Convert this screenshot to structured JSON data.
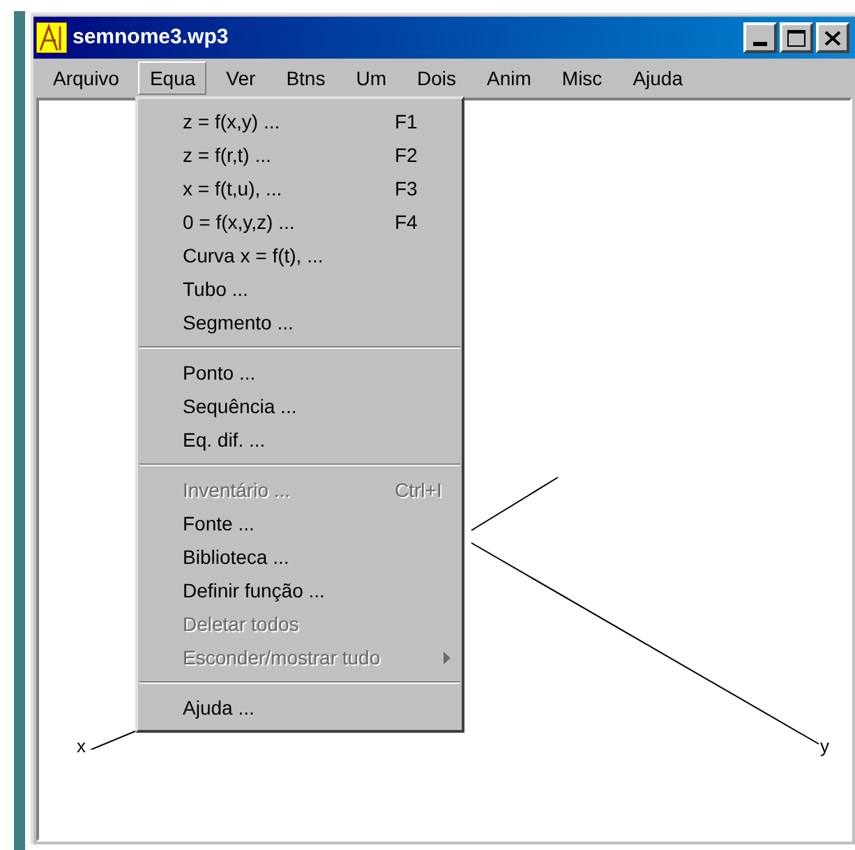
{
  "window": {
    "title": "semnome3.wp3"
  },
  "menu_bar": [
    {
      "label": "Arquivo",
      "selected": false
    },
    {
      "label": "Equa",
      "selected": true
    },
    {
      "label": "Ver",
      "selected": false
    },
    {
      "label": "Btns",
      "selected": false
    },
    {
      "label": "Um",
      "selected": false
    },
    {
      "label": "Dois",
      "selected": false
    },
    {
      "label": "Anim",
      "selected": false
    },
    {
      "label": "Misc",
      "selected": false
    },
    {
      "label": "Ajuda",
      "selected": false
    }
  ],
  "menu": [
    {
      "kind": "item",
      "label": "z = f(x,y) ...",
      "shortcut": "F1",
      "disabled": false
    },
    {
      "kind": "item",
      "label": "z = f(r,t) ...",
      "shortcut": "F2",
      "disabled": false
    },
    {
      "kind": "item",
      "label": "x = f(t,u), ...",
      "shortcut": "F3",
      "disabled": false
    },
    {
      "kind": "item",
      "label": "0 = f(x,y,z) ...",
      "shortcut": "F4",
      "disabled": false
    },
    {
      "kind": "item",
      "label": "Curva x = f(t), ...",
      "disabled": false
    },
    {
      "kind": "item",
      "label": "Tubo ...",
      "disabled": false
    },
    {
      "kind": "item",
      "label": "Segmento ...",
      "disabled": false
    },
    {
      "kind": "separator"
    },
    {
      "kind": "item",
      "label": "Ponto ...",
      "disabled": false
    },
    {
      "kind": "item",
      "label": "Sequência ...",
      "disabled": false
    },
    {
      "kind": "item",
      "label": "Eq. dif. ...",
      "disabled": false
    },
    {
      "kind": "separator"
    },
    {
      "kind": "item",
      "label": "Inventário ...",
      "shortcut": "Ctrl+I",
      "disabled": true
    },
    {
      "kind": "item",
      "label": "Fonte ...",
      "disabled": false
    },
    {
      "kind": "item",
      "label": "Biblioteca ...",
      "disabled": false
    },
    {
      "kind": "item",
      "label": "Definir função ...",
      "disabled": false
    },
    {
      "kind": "item",
      "label": "Deletar todos",
      "disabled": true
    },
    {
      "kind": "item",
      "label": "Esconder/mostrar tudo",
      "disabled": true,
      "submenu": true
    },
    {
      "kind": "separator"
    },
    {
      "kind": "item",
      "label": "Ajuda ...",
      "disabled": false
    }
  ],
  "axes": [
    {
      "label": "x"
    },
    {
      "label": "y"
    }
  ]
}
